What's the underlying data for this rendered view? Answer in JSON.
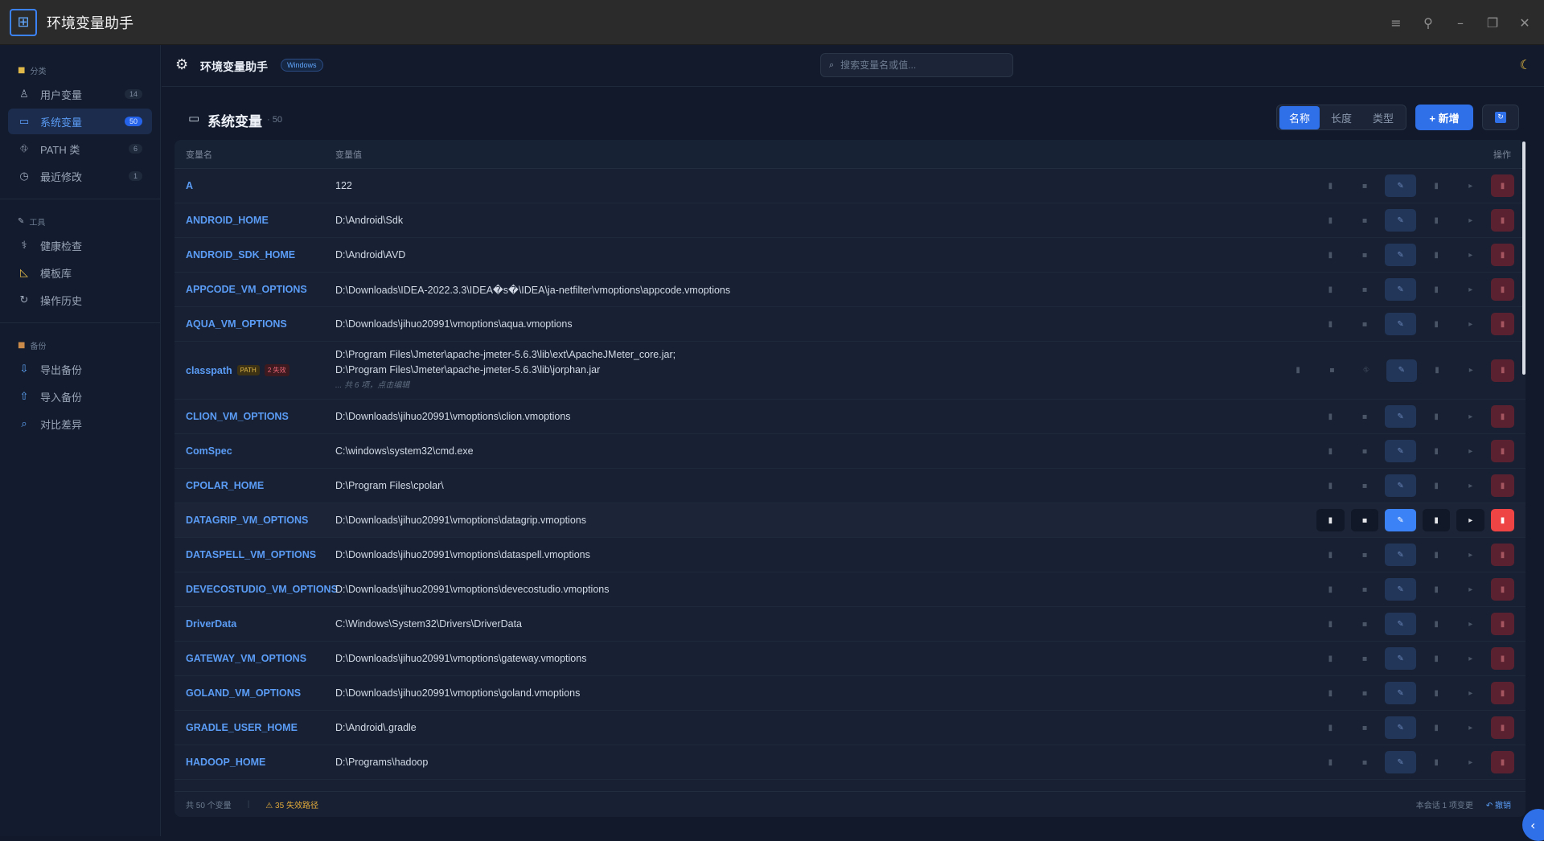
{
  "app": {
    "title": "环境变量助手"
  },
  "window": {
    "icons": [
      "menu-icon",
      "pin-icon",
      "minimize-icon",
      "restore-icon",
      "close-icon"
    ]
  },
  "sidebar": {
    "sections": [
      {
        "heading": "分类",
        "items": [
          {
            "label": "用户变量",
            "count": "14"
          },
          {
            "label": "系统变量",
            "count": "50"
          },
          {
            "label": "PATH 类",
            "count": "6"
          },
          {
            "label": "最近修改",
            "count": "1"
          }
        ]
      },
      {
        "heading": "工具",
        "items": [
          {
            "label": "健康检查"
          },
          {
            "label": "模板库"
          },
          {
            "label": "操作历史"
          }
        ]
      },
      {
        "heading": "备份",
        "items": [
          {
            "label": "导出备份"
          },
          {
            "label": "导入备份"
          },
          {
            "label": "对比差异"
          }
        ]
      }
    ]
  },
  "header": {
    "title": "环境变量助手",
    "os_badge": "Windows",
    "search_placeholder": "搜索变量名或值..."
  },
  "panel": {
    "title": "系统变量",
    "count": "· 50",
    "sort": {
      "name": "名称",
      "length": "长度",
      "type": "类型"
    },
    "add_label": "+ 新增"
  },
  "table": {
    "col_name": "变量名",
    "col_value": "变量值",
    "col_ops": "操作",
    "rows": [
      {
        "name": "A",
        "value": "122"
      },
      {
        "name": "ANDROID_HOME",
        "value": "D:\\Android\\Sdk"
      },
      {
        "name": "ANDROID_SDK_HOME",
        "value": "D:\\Android\\AVD"
      },
      {
        "name": "APPCODE_VM_OPTIONS",
        "value": "D:\\Downloads\\IDEA-2022.3.3\\IDEA�s�\\IDEA\\ja-netfilter\\vmoptions\\appcode.vmoptions"
      },
      {
        "name": "AQUA_VM_OPTIONS",
        "value": "D:\\Downloads\\jihuo20991\\vmoptions\\aqua.vmoptions"
      },
      {
        "name": "classpath",
        "tag_path": "PATH",
        "tag_bad": "2 失效",
        "lines": [
          "D:\\Program Files\\Jmeter\\apache-jmeter-5.6.3\\lib\\ext\\ApacheJMeter_core.jar;",
          "D:\\Program Files\\Jmeter\\apache-jmeter-5.6.3\\lib\\jorphan.jar"
        ],
        "more": "... 共 6 项，点击编辑"
      },
      {
        "name": "CLION_VM_OPTIONS",
        "value": "D:\\Downloads\\jihuo20991\\vmoptions\\clion.vmoptions"
      },
      {
        "name": "ComSpec",
        "value": "C:\\windows\\system32\\cmd.exe"
      },
      {
        "name": "CPOLAR_HOME",
        "value": "D:\\Program Files\\cpolar\\"
      },
      {
        "name": "DATAGRIP_VM_OPTIONS",
        "value": "D:\\Downloads\\jihuo20991\\vmoptions\\datagrip.vmoptions"
      },
      {
        "name": "DATASPELL_VM_OPTIONS",
        "value": "D:\\Downloads\\jihuo20991\\vmoptions\\dataspell.vmoptions"
      },
      {
        "name": "DEVECOSTUDIO_VM_OPTIONS",
        "value": "D:\\Downloads\\jihuo20991\\vmoptions\\devecostudio.vmoptions"
      },
      {
        "name": "DriverData",
        "value": "C:\\Windows\\System32\\Drivers\\DriverData"
      },
      {
        "name": "GATEWAY_VM_OPTIONS",
        "value": "D:\\Downloads\\jihuo20991\\vmoptions\\gateway.vmoptions"
      },
      {
        "name": "GOLAND_VM_OPTIONS",
        "value": "D:\\Downloads\\jihuo20991\\vmoptions\\goland.vmoptions"
      },
      {
        "name": "GRADLE_USER_HOME",
        "value": "D:\\Android\\.gradle"
      },
      {
        "name": "HADOOP_HOME",
        "value": "D:\\Programs\\hadoop"
      }
    ]
  },
  "footer": {
    "total": "共 50 个变量",
    "invalid": "⚠ 35 失效路径",
    "session": "本会话 1 项变更",
    "undo": "↶ 撤销"
  },
  "colors": {
    "accent": "#2f6fe8",
    "link": "#5b9cf6",
    "danger": "#ef4444",
    "warning": "#e0a83a",
    "background": "#11192a"
  }
}
